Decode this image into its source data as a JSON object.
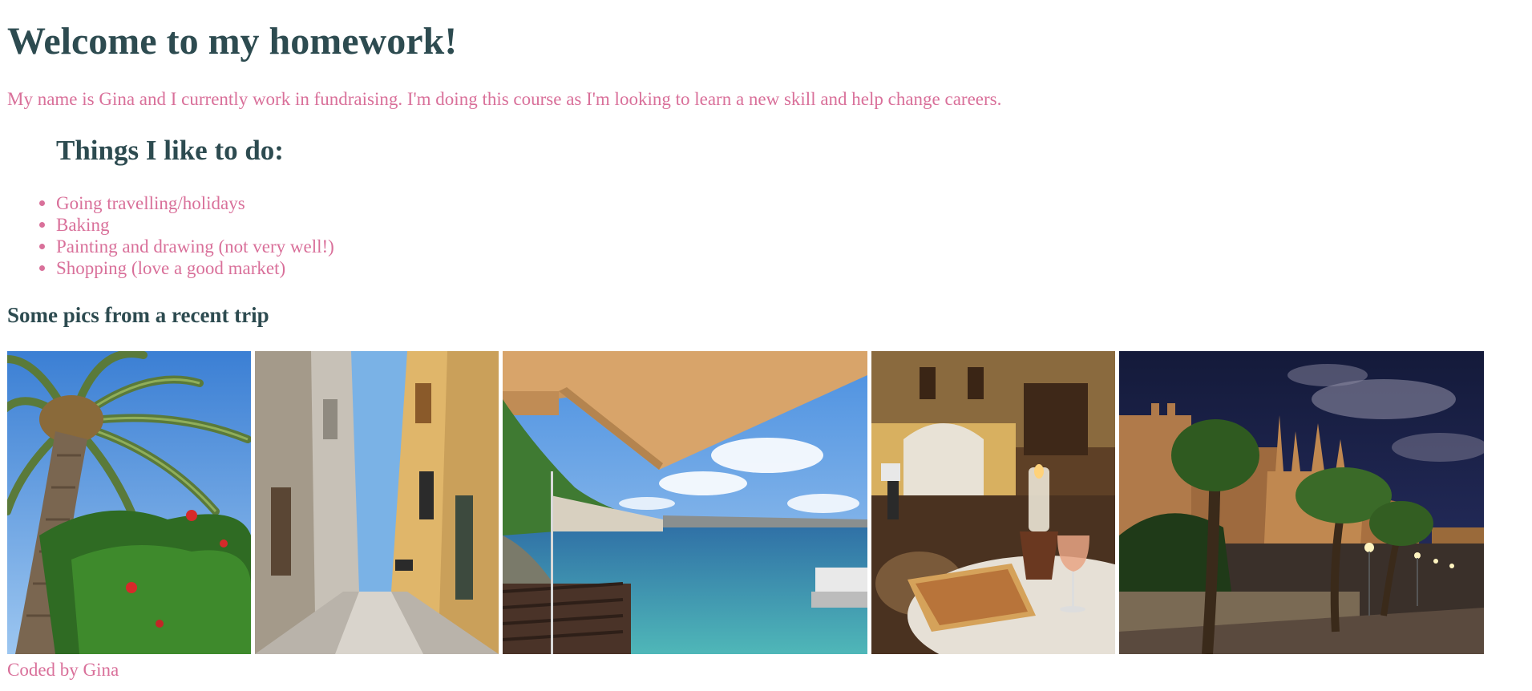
{
  "heading": "Welcome to my homework!",
  "intro": "My name is Gina and I currently work in fundraising. I'm doing this course as I'm looking to learn a new skill and help change careers.",
  "likes": {
    "title": "Things I like to do:",
    "items": [
      "Going travelling/holidays",
      "Baking",
      "Painting and drawing (not very well!)",
      "Shopping (love a good market)"
    ]
  },
  "gallery": {
    "title": "Some pics from a recent trip",
    "photos": [
      {
        "id": "palm-tree-photo"
      },
      {
        "id": "narrow-street-photo"
      },
      {
        "id": "seaside-terrace-photo"
      },
      {
        "id": "courtyard-cafe-photo"
      },
      {
        "id": "cathedral-night-photo"
      }
    ]
  },
  "footer": "Coded by Gina",
  "colors": {
    "heading": "#2d4b50",
    "text": "#d9709a",
    "background": "#ffffff"
  }
}
